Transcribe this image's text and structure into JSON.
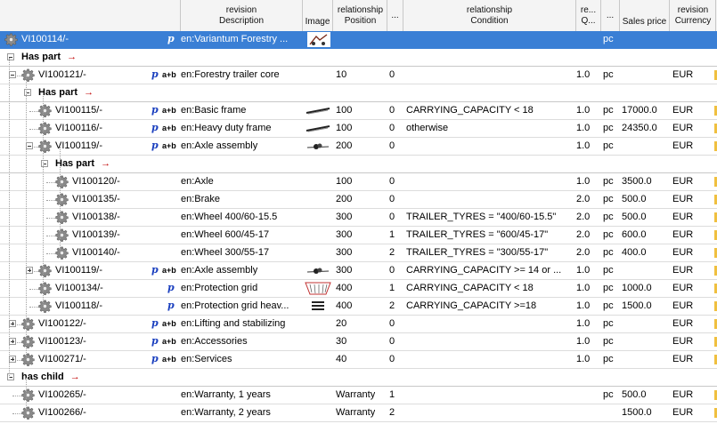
{
  "headers": {
    "revision_description": [
      "revision",
      "Description"
    ],
    "image": "Image",
    "relationship_position": [
      "relationship",
      "Position"
    ],
    "ellipsis1": "...",
    "relationship_condition": [
      "relationship",
      "Condition"
    ],
    "req": [
      "re...",
      "Q..."
    ],
    "ellipsis2": "...",
    "sales_price": "Sales price",
    "revision_currency": [
      "revision",
      "Currency"
    ]
  },
  "rows": [
    {
      "id": "VI100114/-",
      "desc": "en:Variantum Forestry ...",
      "unit": "pc",
      "selected": true
    },
    {
      "group": "Has part"
    },
    {
      "id": "VI100121/-",
      "desc": "en:Forestry trailer core",
      "pos": "10",
      "n": "0",
      "q": "1.0",
      "unit": "pc",
      "cur": "EUR"
    },
    {
      "group": "Has part"
    },
    {
      "id": "VI100115/-",
      "desc": "en:Basic frame",
      "pos": "100",
      "n": "0",
      "cond": "CARRYING_CAPACITY < 18",
      "q": "1.0",
      "unit": "pc",
      "price": "17000.0",
      "cur": "EUR"
    },
    {
      "id": "VI100116/-",
      "desc": "en:Heavy duty frame",
      "pos": "100",
      "n": "0",
      "cond": "otherwise",
      "q": "1.0",
      "unit": "pc",
      "price": "24350.0",
      "cur": "EUR"
    },
    {
      "id": "VI100119/-",
      "desc": "en:Axle assembly",
      "pos": "200",
      "n": "0",
      "q": "1.0",
      "unit": "pc",
      "cur": "EUR"
    },
    {
      "group": "Has part"
    },
    {
      "id": "VI100120/-",
      "desc": "en:Axle",
      "pos": "100",
      "n": "0",
      "q": "1.0",
      "unit": "pc",
      "price": "3500.0",
      "cur": "EUR"
    },
    {
      "id": "VI100135/-",
      "desc": "en:Brake",
      "pos": "200",
      "n": "0",
      "q": "2.0",
      "unit": "pc",
      "price": "500.0",
      "cur": "EUR"
    },
    {
      "id": "VI100138/-",
      "desc": "en:Wheel 400/60-15.5",
      "pos": "300",
      "n": "0",
      "cond": "TRAILER_TYRES = \"400/60-15.5\"",
      "q": "2.0",
      "unit": "pc",
      "price": "500.0",
      "cur": "EUR"
    },
    {
      "id": "VI100139/-",
      "desc": "en:Wheel 600/45-17",
      "pos": "300",
      "n": "1",
      "cond": "TRAILER_TYRES = \"600/45-17\"",
      "q": "2.0",
      "unit": "pc",
      "price": "600.0",
      "cur": "EUR"
    },
    {
      "id": "VI100140/-",
      "desc": "en:Wheel 300/55-17",
      "pos": "300",
      "n": "2",
      "cond": "TRAILER_TYRES = \"300/55-17\"",
      "q": "2.0",
      "unit": "pc",
      "price": "400.0",
      "cur": "EUR"
    },
    {
      "id": "VI100119/-",
      "desc": "en:Axle assembly",
      "pos": "300",
      "n": "0",
      "cond": "CARRYING_CAPACITY >= 14 or ...",
      "q": "1.0",
      "unit": "pc",
      "cur": "EUR"
    },
    {
      "id": "VI100134/-",
      "desc": "en:Protection grid",
      "pos": "400",
      "n": "1",
      "cond": "CARRYING_CAPACITY < 18",
      "q": "1.0",
      "unit": "pc",
      "price": "1000.0",
      "cur": "EUR"
    },
    {
      "id": "VI100118/-",
      "desc": "en:Protection grid heav...",
      "pos": "400",
      "n": "2",
      "cond": "CARRYING_CAPACITY  >=18",
      "q": "1.0",
      "unit": "pc",
      "price": "1500.0",
      "cur": "EUR"
    },
    {
      "id": "VI100122/-",
      "desc": "en:Lifting and stabilizing",
      "pos": "20",
      "n": "0",
      "q": "1.0",
      "unit": "pc",
      "cur": "EUR"
    },
    {
      "id": "VI100123/-",
      "desc": "en:Accessories",
      "pos": "30",
      "n": "0",
      "q": "1.0",
      "unit": "pc",
      "cur": "EUR"
    },
    {
      "id": "VI100271/-",
      "desc": "en:Services",
      "pos": "40",
      "n": "0",
      "q": "1.0",
      "unit": "pc",
      "cur": "EUR"
    },
    {
      "group": "has child"
    },
    {
      "id": "VI100265/-",
      "desc": "en:Warranty, 1 years",
      "pos": "Warranty",
      "n": "1",
      "unit": "pc",
      "price": "500.0",
      "cur": "EUR"
    },
    {
      "id": "VI100266/-",
      "desc": "en:Warranty, 2 years",
      "pos": "Warranty",
      "n": "2",
      "price": "1500.0",
      "cur": "EUR"
    }
  ],
  "icons": {
    "p": "p",
    "ab": "a+b"
  },
  "colors": {
    "selection": "#3a7fd5",
    "arrow": "#c00000",
    "p_icon": "#1a3fbf"
  }
}
